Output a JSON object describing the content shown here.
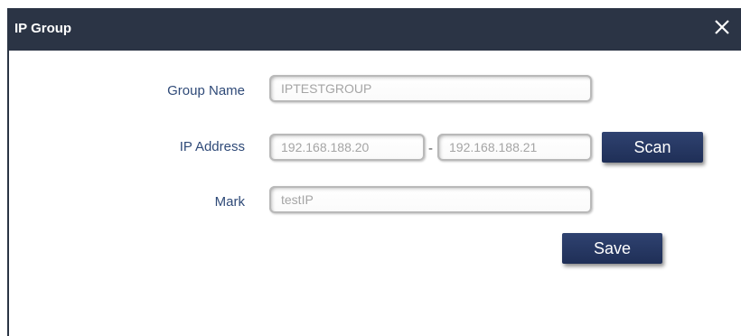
{
  "dialog": {
    "title": "IP Group",
    "close_icon": "close-icon"
  },
  "form": {
    "group_name": {
      "label": "Group Name",
      "value": "IPTESTGROUP"
    },
    "ip_address": {
      "label": "IP Address",
      "start_value": "192.168.188.20",
      "separator": "-",
      "end_value": "192.168.188.21"
    },
    "mark": {
      "label": "Mark",
      "value": "testIP"
    }
  },
  "buttons": {
    "scan_label": "Scan",
    "save_label": "Save"
  },
  "colors": {
    "titlebar": "#2b3445",
    "label": "#2f4a78",
    "button": "#24355f",
    "field_text": "#a5a5a5"
  }
}
